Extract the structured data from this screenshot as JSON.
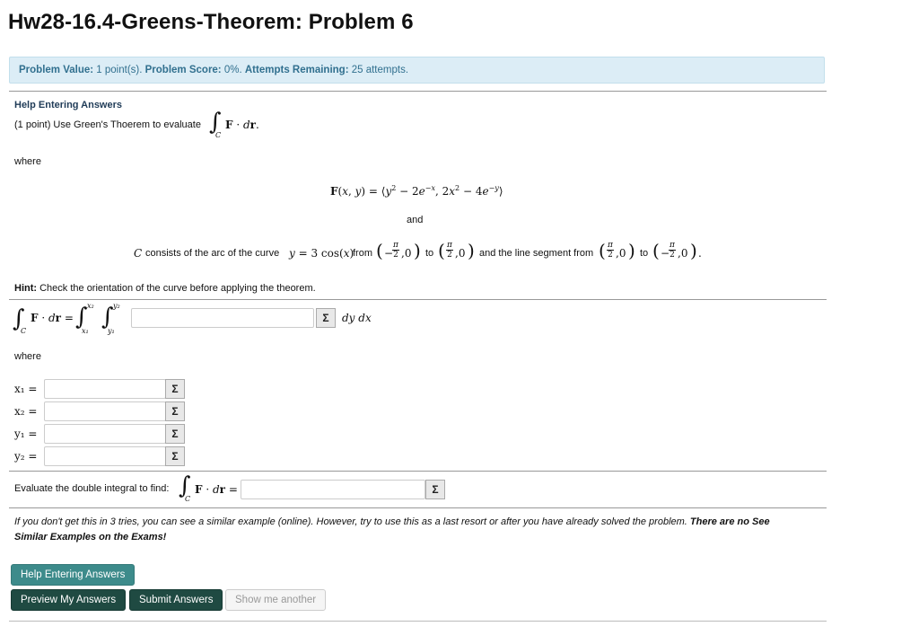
{
  "page_title": "Hw28-16.4-Greens-Theorem: Problem 6",
  "info": {
    "value_label": "Problem Value:",
    "value": "1 point(s).",
    "score_label": "Problem Score:",
    "score": "0%.",
    "attempts_label": "Attempts Remaining:",
    "attempts": "25 attempts."
  },
  "help_link": "Help Entering Answers",
  "problem": {
    "intro": "(1 point) Use Green's Thoerem to evaluate",
    "where1": "where",
    "and": "and",
    "c_consists": "consists of the arc of the curve",
    "from": "from",
    "to": "to",
    "and_line": "and the line segment from",
    "to2": "to",
    "hint_label": "Hint:",
    "hint_text": "Check the orientation of the curve before applying the theorem.",
    "where2": "where",
    "evaluate": "Evaluate the double integral to find:",
    "dydx": "dy dx"
  },
  "limits": [
    {
      "label": "x₁ =",
      "value": ""
    },
    {
      "label": "x₂ =",
      "value": ""
    },
    {
      "label": "y₁ =",
      "value": ""
    },
    {
      "label": "y₂ =",
      "value": ""
    }
  ],
  "sigma": "Σ",
  "note": {
    "text": "If you don't get this in 3 tries, you can see a similar example (online). However, try to use this as a last resort or after you have already solved the problem.",
    "bold": "There are no See",
    "line2": "Similar Examples on the Exams!"
  },
  "buttons": {
    "help": "Help Entering Answers",
    "preview": "Preview My Answers",
    "submit": "Submit Answers",
    "another": "Show me another"
  }
}
